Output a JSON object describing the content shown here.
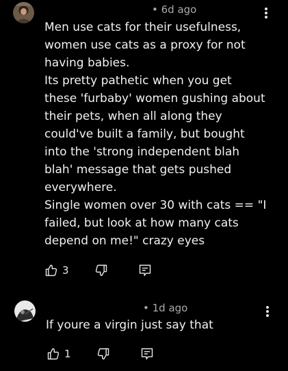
{
  "comments": [
    {
      "age": "6d ago",
      "paragraphs": [
        "Men use cats for their usefulness, women use cats as a proxy for not having babies.",
        "Its pretty pathetic when you get these 'furbaby' women gushing about their pets, when all along they could've built a family, but bought into the 'strong independent blah blah' message that gets pushed everywhere.",
        "Single women over 30 with cats == \"I failed, but look at how many cats depend on me!\" crazy eyes"
      ],
      "likes": "3"
    },
    {
      "age": "1d ago",
      "paragraphs": [
        "If youre a virgin just say that"
      ],
      "likes": "1"
    }
  ],
  "colors": {
    "background": "#000000",
    "text": "#f1f1f1",
    "meta": "#aaaaaa"
  },
  "icons": {
    "like": "thumbs-up-icon",
    "dislike": "thumbs-down-icon",
    "reply": "reply-icon",
    "menu": "more-vertical-icon"
  }
}
